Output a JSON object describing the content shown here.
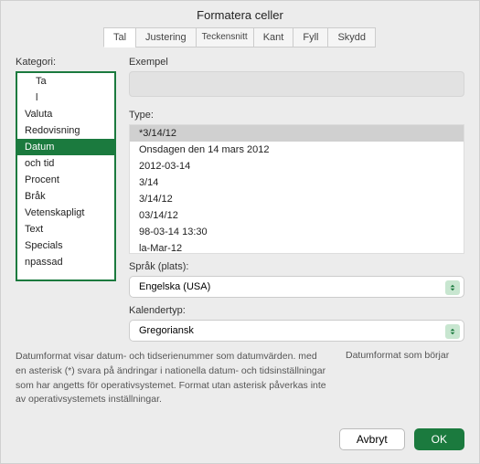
{
  "title": "Formatera celler",
  "tabs": [
    "Tal",
    "Justering",
    "Teckensnitt",
    "Kant",
    "Fyll",
    "Skydd"
  ],
  "activeTab": 0,
  "categoryLabel": "Kategori:",
  "categories": [
    "Ta",
    "l",
    "Valuta",
    "Redovisning",
    "Datum",
    "och tid",
    "Procent",
    "Bråk",
    "Vetenskapligt",
    "Text",
    "Specials",
    "npassad"
  ],
  "selectedCategory": 4,
  "exampleLabel": "Exempel",
  "typeLabel": "Type:",
  "types": [
    "*3/14/12",
    "Onsdagen den 14 mars 2012",
    "2012-03-14",
    "3/14",
    "3/14/12",
    "03/14/12",
    "98-03-14 13:30",
    "la-Mar-12"
  ],
  "selectedType": 0,
  "localeLabel": "Språk (plats):",
  "localeValue": "Engelska (USA)",
  "calendarLabel": "Kalendertyp:",
  "calendarValue": "Gregoriansk",
  "noteLeft": "Datumformat visar datum- och tidserienummer som datumvärden. med en asterisk (*) svara på ändringar i nationella datum- och tidsinställningar som har angetts för operativsystemet. Format utan asterisk påverkas inte av operativsystemets inställningar.",
  "noteRight": "Datumformat som börjar",
  "cancel": "Avbryt",
  "ok": "OK"
}
